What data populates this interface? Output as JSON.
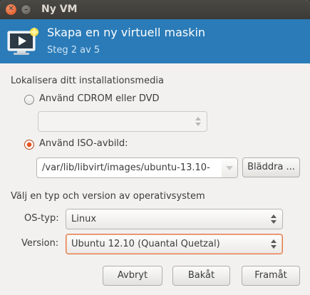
{
  "window": {
    "title": "Ny VM"
  },
  "banner": {
    "title": "Skapa en ny virtuell maskin",
    "subtitle": "Steg 2 av 5",
    "icon": "monitor-play-icon"
  },
  "install_media": {
    "heading": "Lokalisera ditt installationsmedia",
    "cdrom_label": "Använd CDROM eller DVD",
    "cdrom_selected": false,
    "cdrom_value": "",
    "iso_label": "Använd ISO-avbild:",
    "iso_selected": true,
    "iso_path": "/var/lib/libvirt/images/ubuntu-13.10-",
    "browse_label": "Bläddra ..."
  },
  "os": {
    "heading": "Välj en typ och version av operativsystem",
    "type_label": "OS-typ:",
    "type_value": "Linux",
    "version_label": "Version:",
    "version_value": "Ubuntu 12.10 (Quantal Quetzal)"
  },
  "footer": {
    "cancel_label": "Avbryt",
    "back_label": "Bakåt",
    "forward_label": "Framåt"
  },
  "colors": {
    "banner": "#2a7bb8",
    "accent": "#e8521f"
  }
}
